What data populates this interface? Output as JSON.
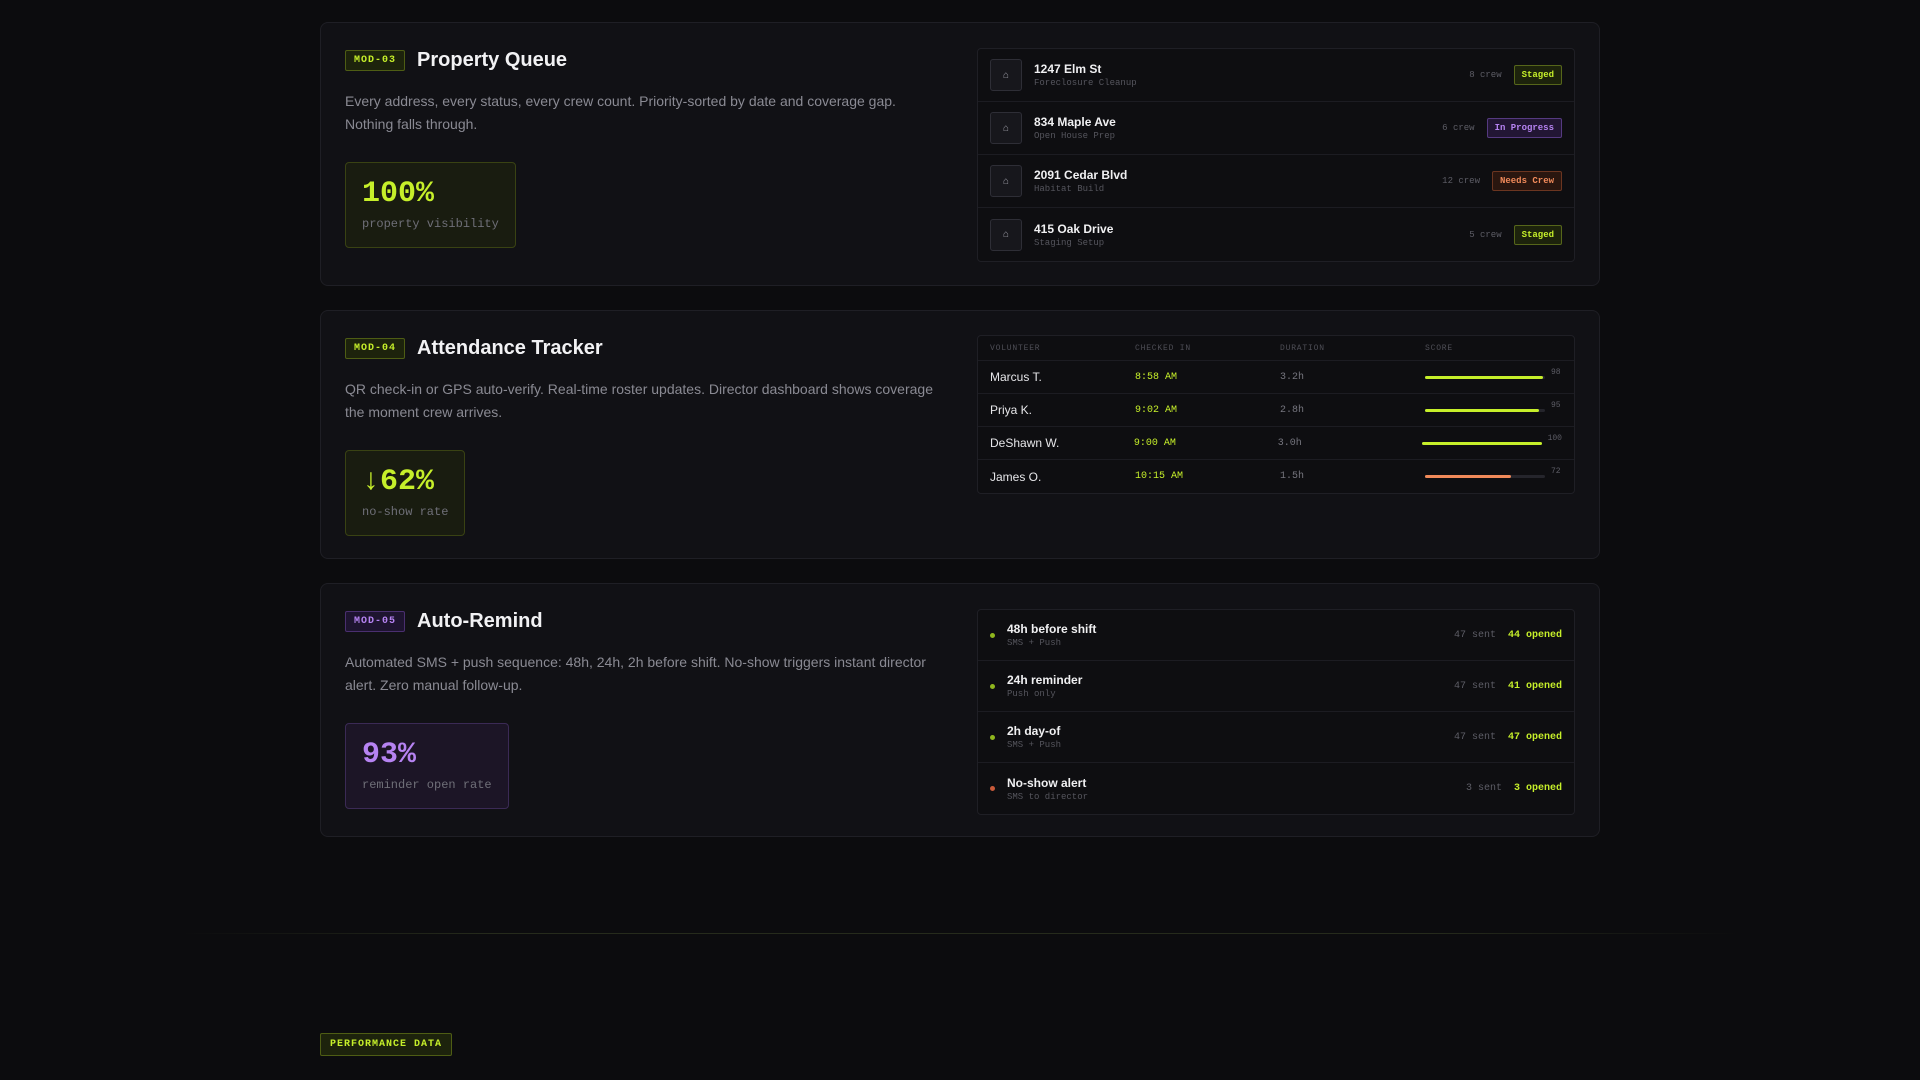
{
  "colors": {
    "accent": "#c6ef2a",
    "purple": "#b683f2",
    "orange": "#f08a5a",
    "background": "#0c0c0e",
    "card": "#111115"
  },
  "modules": {
    "property": {
      "tag": "MOD-03",
      "title": "Property Queue",
      "description": "Every address, every status, every crew count. Priority-sorted by date and coverage gap. Nothing falls through.",
      "stat_value": "100%",
      "stat_label": "property visibility",
      "items": [
        {
          "icon": "house-icon",
          "address": "1247 Elm St",
          "type": "Foreclosure Cleanup",
          "crew": "8 crew",
          "status": "Staged"
        },
        {
          "icon": "house-icon",
          "address": "834 Maple Ave",
          "type": "Open House Prep",
          "crew": "6 crew",
          "status": "In Progress"
        },
        {
          "icon": "house-icon",
          "address": "2091 Cedar Blvd",
          "type": "Habitat Build",
          "crew": "12 crew",
          "status": "Needs Crew"
        },
        {
          "icon": "house-icon",
          "address": "415 Oak Drive",
          "type": "Staging Setup",
          "crew": "5 crew",
          "status": "Staged"
        }
      ]
    },
    "attendance": {
      "tag": "MOD-04",
      "title": "Attendance Tracker",
      "description": "QR check-in or GPS auto-verify. Real-time roster updates. Director dashboard shows coverage the moment crew arrives.",
      "stat_value": "↓62%",
      "stat_label": "no-show rate",
      "columns": [
        "VOLUNTEER",
        "CHECKED IN",
        "DURATION",
        "SCORE"
      ],
      "rows": [
        {
          "name": "Marcus T.",
          "checked_in": "8:58 AM",
          "duration": "3.2h",
          "score": 98
        },
        {
          "name": "Priya K.",
          "checked_in": "9:02 AM",
          "duration": "2.8h",
          "score": 95
        },
        {
          "name": "DeShawn W.",
          "checked_in": "9:00 AM",
          "duration": "3.0h",
          "score": 100
        },
        {
          "name": "James O.",
          "checked_in": "10:15 AM",
          "duration": "1.5h",
          "score": 72
        }
      ]
    },
    "remind": {
      "tag": "MOD-05",
      "title": "Auto-Remind",
      "description": "Automated SMS + push sequence: 48h, 24h, 2h before shift. No-show triggers instant director alert. Zero manual follow-up.",
      "stat_value": "93%",
      "stat_label": "reminder open rate",
      "items": [
        {
          "title": "48h before shift",
          "channel": "SMS + Push",
          "sent": "47 sent",
          "opened": "44 opened",
          "dot": "#8fb61e"
        },
        {
          "title": "24h reminder",
          "channel": "Push only",
          "sent": "47 sent",
          "opened": "41 opened",
          "dot": "#8fb61e"
        },
        {
          "title": "2h day-of",
          "channel": "SMS + Push",
          "sent": "47 sent",
          "opened": "47 opened",
          "dot": "#8fb61e"
        },
        {
          "title": "No-show alert",
          "channel": "SMS to director",
          "sent": "3 sent",
          "opened": "3 opened",
          "dot": "#c85a3a"
        }
      ]
    }
  },
  "footer": {
    "section_tag": "PERFORMANCE DATA"
  }
}
